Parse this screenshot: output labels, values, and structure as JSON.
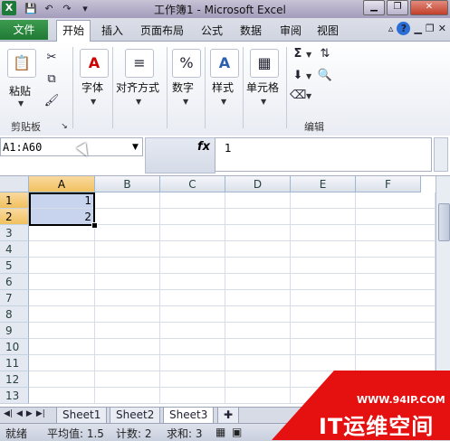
{
  "window": {
    "title": "工作簿1 - Microsoft Excel",
    "app_icon": "X",
    "buttons": {
      "minimize": "▁",
      "restore": "❐",
      "close": "✕"
    }
  },
  "qat": {
    "save": "💾",
    "undo": "↶",
    "redo": "↷",
    "customize": "▾"
  },
  "tabs": {
    "file": "文件",
    "items": [
      "开始",
      "插入",
      "页面布局",
      "公式",
      "数据",
      "审阅",
      "视图"
    ],
    "active": "开始"
  },
  "ribbon": {
    "clipboard": {
      "paste": "粘贴",
      "group_label": "剪贴板"
    },
    "font": {
      "label": "字体"
    },
    "alignment": {
      "label": "对齐方式"
    },
    "number": {
      "label": "数字",
      "icon": "%"
    },
    "styles": {
      "label": "样式"
    },
    "cells": {
      "label": "单元格"
    },
    "editing": {
      "group_label": "编辑"
    }
  },
  "formula_bar": {
    "name_box": "A1:A60",
    "fx": "fx",
    "value": "1"
  },
  "grid": {
    "columns": [
      "A",
      "B",
      "C",
      "D",
      "E",
      "F"
    ],
    "rows": [
      "1",
      "2",
      "3",
      "4",
      "5",
      "6",
      "7",
      "8",
      "9",
      "10",
      "11",
      "12",
      "13"
    ],
    "cells": {
      "A1": "1",
      "A2": "2"
    }
  },
  "sheets": {
    "tabs": [
      "Sheet1",
      "Sheet2",
      "Sheet3"
    ],
    "active": "Sheet3"
  },
  "status": {
    "mode": "就绪",
    "average": "平均值: 1.5",
    "count": "计数: 2",
    "sum": "求和: 3"
  },
  "watermark": {
    "url": "WWW.94IP.COM",
    "brand": "IT运维空间"
  },
  "colors": {
    "file_tab": "#1f7a34",
    "selection": "#c8d4ee",
    "header_selected": "#f1c15f",
    "watermark_red": "#e51111"
  }
}
